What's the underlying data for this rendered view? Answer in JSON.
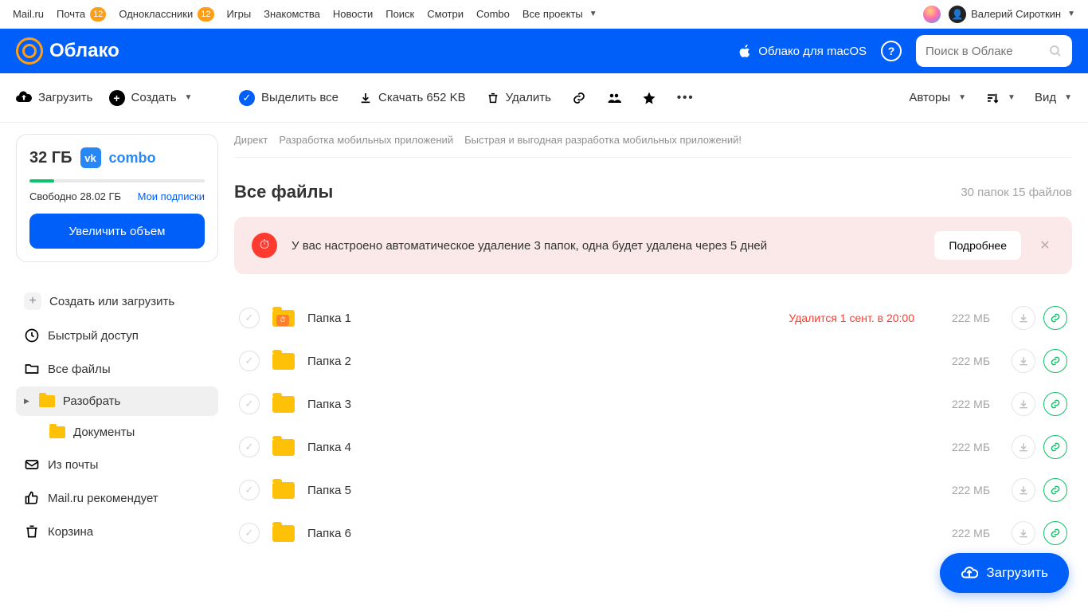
{
  "topnav": {
    "items": [
      {
        "label": "Mail.ru"
      },
      {
        "label": "Почта",
        "badge": "12"
      },
      {
        "label": "Одноклассники",
        "badge": "12"
      },
      {
        "label": "Игры"
      },
      {
        "label": "Знакомства"
      },
      {
        "label": "Новости"
      },
      {
        "label": "Поиск"
      },
      {
        "label": "Смотри"
      },
      {
        "label": "Combo"
      },
      {
        "label": "Все проекты",
        "caret": true
      }
    ],
    "user_name": "Валерий Сироткин"
  },
  "bluebar": {
    "brand": "Облако",
    "macos_link": "Облако для macOS",
    "search_placeholder": "Поиск в Облаке"
  },
  "toolbar": {
    "upload": "Загрузить",
    "create": "Создать",
    "select_all": "Выделить все",
    "download": "Скачать 652 KB",
    "delete": "Удалить",
    "authors": "Авторы",
    "view": "Вид"
  },
  "sidebar": {
    "quota_total": "32 ГБ",
    "combo": "combo",
    "free_label": "Свободно 28.02 ГБ",
    "subs_link": "Мои подписки",
    "increase_btn": "Увеличить объем",
    "items": [
      {
        "icon": "plus",
        "label": "Создать или загрузить"
      },
      {
        "icon": "clock",
        "label": "Быстрый доступ"
      },
      {
        "icon": "folder-outline",
        "label": "Все файлы"
      },
      {
        "icon": "folder",
        "label": "Разобрать",
        "active": true,
        "chevron": true
      },
      {
        "icon": "folder",
        "label": "Документы",
        "child": true
      },
      {
        "icon": "mail",
        "label": "Из почты"
      },
      {
        "icon": "recommend",
        "label": "Mail.ru рекомендует"
      },
      {
        "icon": "trash",
        "label": "Корзина"
      }
    ]
  },
  "ad": {
    "label": "Директ",
    "t1": "Разработка мобильных приложений",
    "t2": "Быстрая и выгодная разработка мобильных приложений!"
  },
  "main": {
    "heading": "Все файлы",
    "meta": "30 папок 15 файлов",
    "notice_text": "У вас настроено автоматическое удаление 3 папок, одна будет удалена через 5 дней",
    "notice_btn": "Подробнее",
    "files": [
      {
        "name": "Папка 1",
        "size": "222 МБ",
        "warn": "Удалится 1 сент. в 20:00",
        "badge": true
      },
      {
        "name": "Папка 2",
        "size": "222 МБ"
      },
      {
        "name": "Папка 3",
        "size": "222 МБ"
      },
      {
        "name": "Папка 4",
        "size": "222 МБ"
      },
      {
        "name": "Папка 5",
        "size": "222 МБ"
      },
      {
        "name": "Папка 6",
        "size": "222 МБ"
      }
    ]
  },
  "fab": "Загрузить"
}
